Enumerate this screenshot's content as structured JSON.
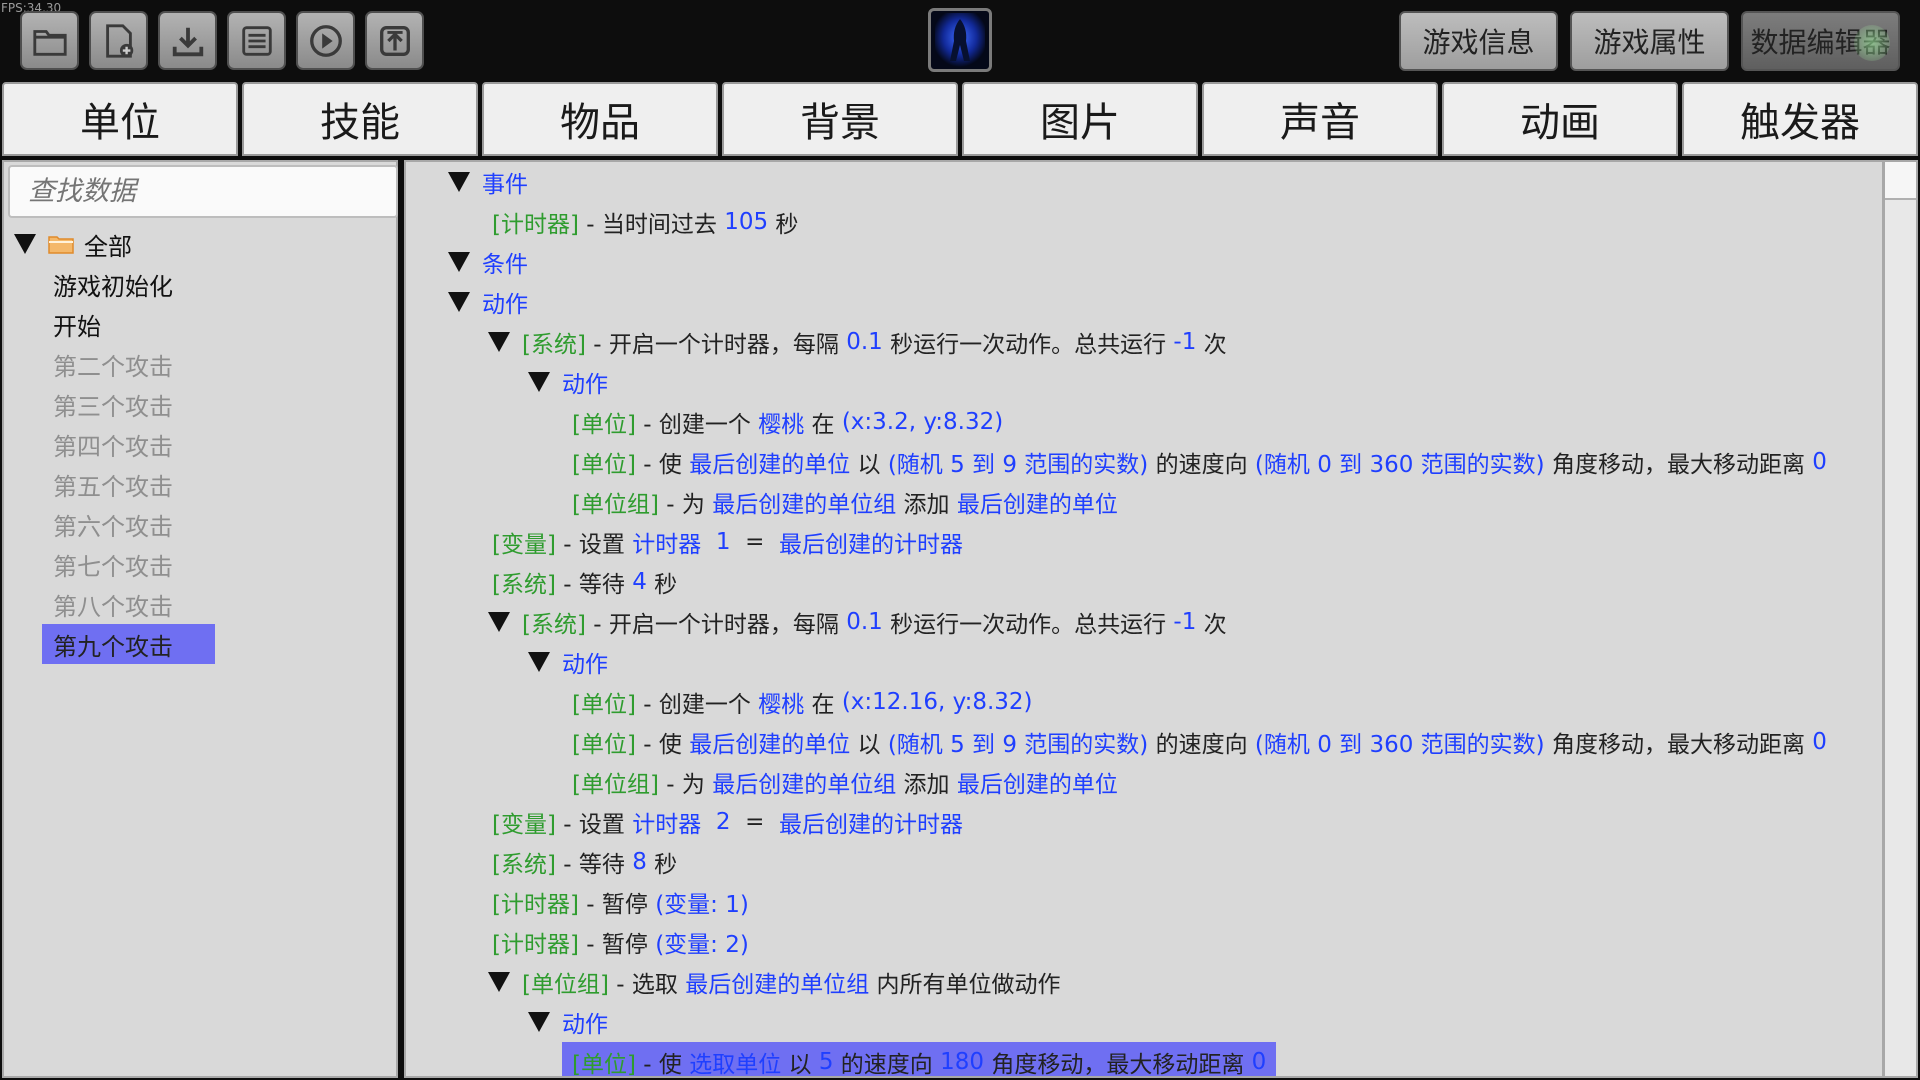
{
  "fps": "FPS:34.30",
  "toolbar": {
    "icons": [
      "folder-icon",
      "new-file-icon",
      "download-icon",
      "save-icon",
      "play-icon",
      "upload-icon"
    ],
    "buttons": {
      "game_info": "游戏信息",
      "game_props": "游戏属性",
      "data_editor": "数据编辑器"
    }
  },
  "tabs": [
    "单位",
    "技能",
    "物品",
    "背景",
    "图片",
    "声音",
    "动画",
    "触发器"
  ],
  "sidebar": {
    "search_placeholder": "查找数据",
    "root_label": "全部",
    "items": [
      "游戏初始化",
      "开始",
      "第二个攻击",
      "第三个攻击",
      "第四个攻击",
      "第五个攻击",
      "第六个攻击",
      "第七个攻击",
      "第八个攻击",
      "第九个攻击"
    ]
  },
  "tree": {
    "event_header": "事件",
    "event_line": {
      "tag": "[计时器]",
      "text1": "- 当时间过去",
      "seconds": "105",
      "text2": "秒"
    },
    "cond_header": "条件",
    "action_header": "动作",
    "block1": {
      "tag": "[系统]",
      "text1": "- 开启一个计时器，每隔",
      "interval": "0.1",
      "text2": "秒运行一次动作。总共运行",
      "count": "-1",
      "text3": "次",
      "sub_header": "动作",
      "create": {
        "tag": "[单位]",
        "text1": "- 创建一个",
        "unit": "樱桃",
        "text2": "在",
        "pos": "(x:3.2, y:8.32)"
      },
      "move": {
        "tag": "[单位]",
        "text1": "- 使",
        "target": "最后创建的单位",
        "text2": "以",
        "speed": "(随机 5 到 9 范围的实数)",
        "text3": "的速度向",
        "angle": "(随机 0 到 360 范围的实数)",
        "text4": "角度移动，最大移动距离",
        "dist": "0"
      },
      "group": {
        "tag": "[单位组]",
        "text1": "- 为",
        "group": "最后创建的单位组",
        "text2": "添加",
        "unit": "最后创建的单位"
      }
    },
    "var1": {
      "tag": "[变量]",
      "text1": "- 设置",
      "var": "计时器",
      "index": "1",
      "eq": "=",
      "value": "最后创建的计时器"
    },
    "wait1": {
      "tag": "[系统]",
      "text1": "- 等待",
      "secs": "4",
      "text2": "秒"
    },
    "block2": {
      "tag": "[系统]",
      "text1": "- 开启一个计时器，每隔",
      "interval": "0.1",
      "text2": "秒运行一次动作。总共运行",
      "count": "-1",
      "text3": "次",
      "sub_header": "动作",
      "create": {
        "tag": "[单位]",
        "text1": "- 创建一个",
        "unit": "樱桃",
        "text2": "在",
        "pos": "(x:12.16, y:8.32)"
      },
      "move": {
        "tag": "[单位]",
        "text1": "- 使",
        "target": "最后创建的单位",
        "text2": "以",
        "speed": "(随机 5 到 9 范围的实数)",
        "text3": "的速度向",
        "angle": "(随机 0 到 360 范围的实数)",
        "text4": "角度移动，最大移动距离",
        "dist": "0"
      },
      "group": {
        "tag": "[单位组]",
        "text1": "- 为",
        "group": "最后创建的单位组",
        "text2": "添加",
        "unit": "最后创建的单位"
      }
    },
    "var2": {
      "tag": "[变量]",
      "text1": "- 设置",
      "var": "计时器",
      "index": "2",
      "eq": "=",
      "value": "最后创建的计时器"
    },
    "wait2": {
      "tag": "[系统]",
      "text1": "- 等待",
      "secs": "8",
      "text2": "秒"
    },
    "pause1": {
      "tag": "[计时器]",
      "text1": "- 暂停",
      "target": "(变量: 1)"
    },
    "pause2": {
      "tag": "[计时器]",
      "text1": "- 暂停",
      "target": "(变量: 2)"
    },
    "pick": {
      "tag": "[单位组]",
      "text1": "- 选取",
      "group": "最后创建的单位组",
      "text2": "内所有单位做动作"
    },
    "pick_header": "动作",
    "pick_move": {
      "tag": "[单位]",
      "text1": "- 使",
      "target": "选取单位",
      "text2": "以",
      "speed": "5",
      "text3": "的速度向",
      "angle": "180",
      "text4": "角度移动，最大移动距离",
      "dist": "0"
    }
  }
}
